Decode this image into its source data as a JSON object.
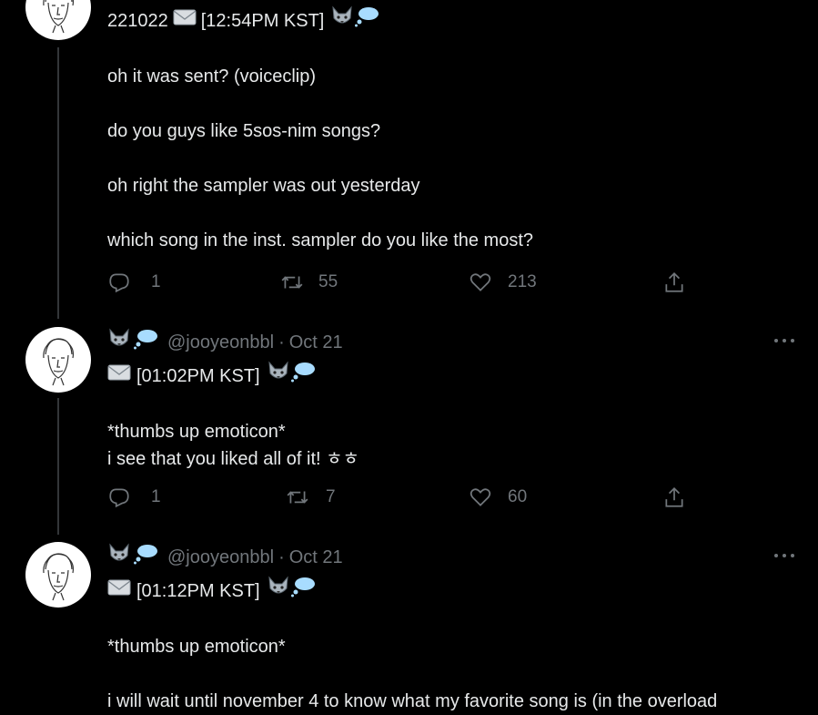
{
  "colors": {
    "background": "#000000",
    "text_primary": "#e7e9ea",
    "text_secondary": "#71767b",
    "thread_line": "#333639"
  },
  "tweets": [
    {
      "body_first_line": "221022 ✉️ [12:54PM KST] 🐺💭",
      "date_prefix": "221022",
      "time_text": "[12:54PM KST]",
      "lines": [
        "oh it was sent? (voiceclip)",
        "do you guys like 5sos-nim songs?",
        "oh right the sampler was out yesterday",
        "which song in the inst. sampler do you like the most?"
      ],
      "replies": "1",
      "retweets": "55",
      "likes": "213",
      "icons": [
        "reply-icon",
        "retweet-icon",
        "like-icon",
        "share-icon"
      ]
    },
    {
      "handle": "@jooyeonbbl",
      "separator": "·",
      "date": "Oct 21",
      "time_text": "[01:02PM KST]",
      "lines": [
        "*thumbs up emoticon*",
        "i see that you liked all of it! ㅎㅎ"
      ],
      "replies": "1",
      "retweets": "7",
      "likes": "60"
    },
    {
      "handle": "@jooyeonbbl",
      "separator": "·",
      "date": "Oct 21",
      "time_text": "[01:12PM KST]",
      "lines": [
        "*thumbs up emoticon*",
        "i will wait until november 4 to know what my favorite song is (in the overload"
      ]
    }
  ]
}
